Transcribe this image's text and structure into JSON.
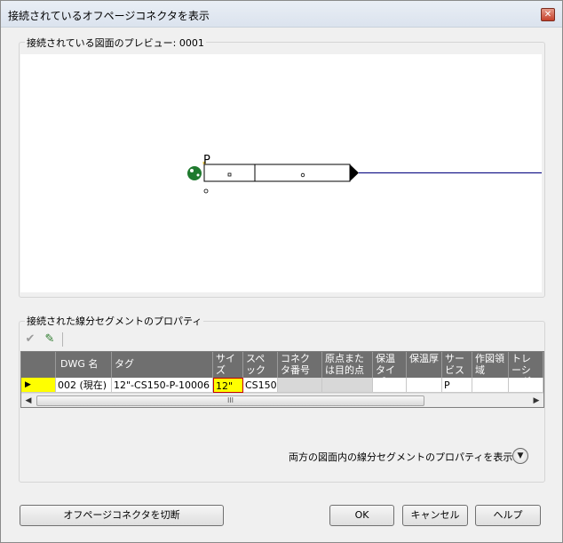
{
  "window": {
    "title": "接続されているオフページコネクタを表示",
    "close_glyph": "✕"
  },
  "preview": {
    "label": "接続されている図面のプレビュー: 0001",
    "connector_letter": "P"
  },
  "properties": {
    "label": "接続された線分セグメントのプロパティ",
    "columns": [
      "",
      "DWG 名",
      "タグ",
      "サイズ",
      "スペック",
      "コネクタ番号",
      "原点または目的点",
      "保温タイプ",
      "保温厚",
      "サービス",
      "作図領域",
      "トレーシング"
    ],
    "rows": [
      {
        "indicator": "▶",
        "dwg_name": "002 (現在)",
        "tag": "12\"-CS150-P-10006",
        "size": "12\"",
        "spec": "CS150",
        "connector_no": "",
        "origin": "",
        "insul_type": "",
        "insul_thick": "",
        "service": "P",
        "drawing_area": "",
        "tracing": ""
      }
    ],
    "scroll_grip": "III"
  },
  "show_both_label": "両方の図面内の線分セグメントのプロパティを表示",
  "buttons": {
    "disconnect": "オフページコネクタを切断",
    "ok": "OK",
    "cancel": "キャンセル",
    "help": "ヘルプ"
  },
  "colors": {
    "pipe_line": "#1a1a8c",
    "highlight_cell": "#ffff00",
    "size_cell": "#ffff00",
    "header_bg": "#6f6f6f",
    "connector_green": "#1f7a2e"
  }
}
